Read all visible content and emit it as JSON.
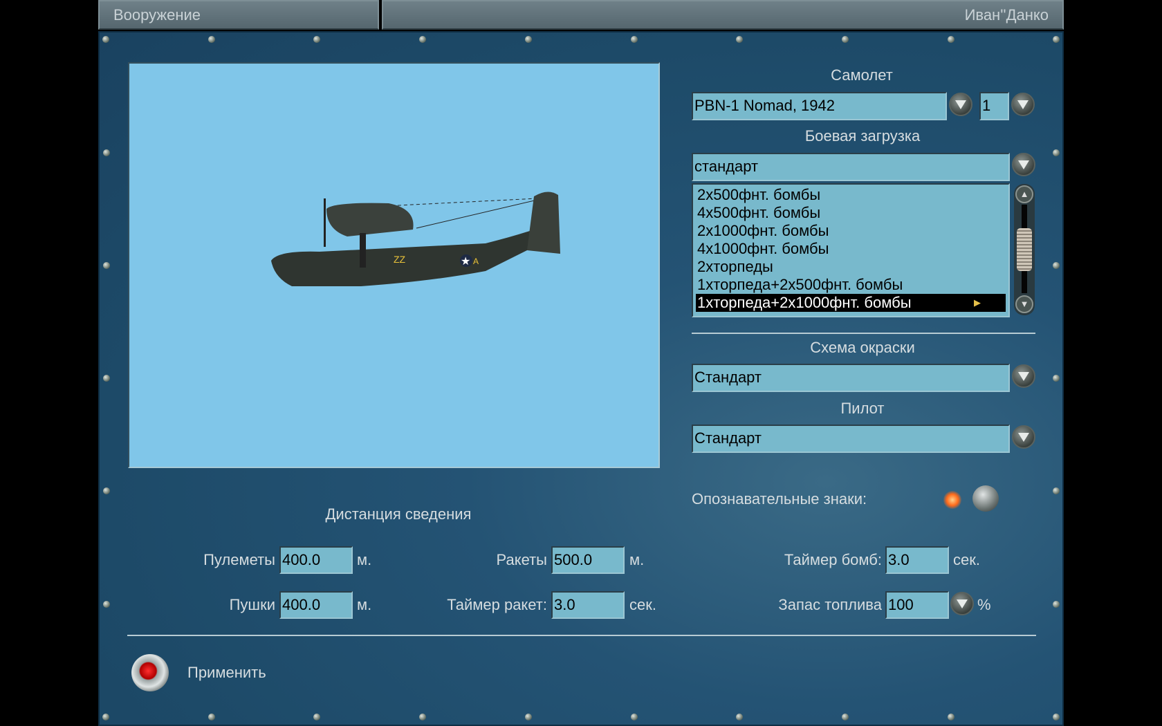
{
  "header": {
    "section": "Вооружение",
    "player": "Иван''Данко"
  },
  "aircraft": {
    "label": "Самолет",
    "value": "PBN-1 Nomad, 1942",
    "count": "1"
  },
  "loadout": {
    "label": "Боевая загрузка",
    "value": "стандарт",
    "options": [
      "2x500фнт. бомбы",
      "4x500фнт. бомбы",
      "2x1000фнт. бомбы",
      "4x1000фнт. бомбы",
      "2xторпеды",
      "1xторпеда+2x500фнт. бомбы",
      "1xторпеда+2x1000фнт. бомбы"
    ],
    "selected_index": 6
  },
  "skin": {
    "label": "Схема окраски",
    "value": "Стандарт"
  },
  "pilot": {
    "label": "Пилот",
    "value": "Стандарт"
  },
  "markings": {
    "label": "Опознавательные знаки:",
    "enabled": true
  },
  "convergence": {
    "title": "Дистанция сведения",
    "mg": {
      "label": "Пулеметы",
      "value": "400.0",
      "unit": "м."
    },
    "cannon": {
      "label": "Пушки",
      "value": "400.0",
      "unit": "м."
    },
    "rockets": {
      "label": "Ракеты",
      "value": "500.0",
      "unit": "м."
    },
    "rocket_timer": {
      "label": "Таймер ракет:",
      "value": "3.0",
      "unit": "сек."
    },
    "bomb_timer": {
      "label": "Таймер бомб:",
      "value": "3.0",
      "unit": "сек."
    },
    "fuel": {
      "label": "Запас топлива",
      "value": "100",
      "unit": "%"
    }
  },
  "apply": {
    "label": "Применить"
  },
  "colors": {
    "panel": "#1d4a68",
    "field": "#78b9cc",
    "sky": "#80c6e9"
  }
}
